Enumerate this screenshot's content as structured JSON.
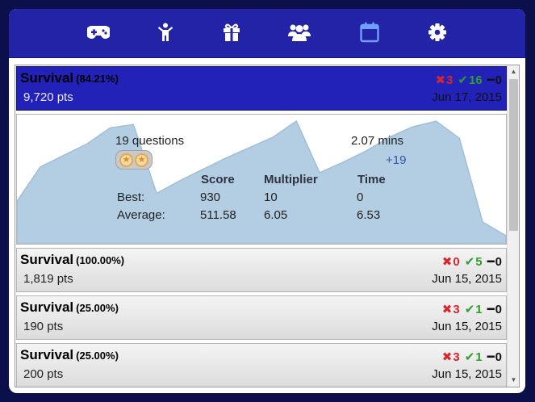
{
  "nav": {
    "icons": [
      "gamepad-icon",
      "person-icon",
      "gift-icon",
      "group-icon",
      "calendar-icon",
      "gear-icon"
    ],
    "active": "calendar-icon",
    "accent_color": "#2323a8",
    "active_color": "#6fa0ff"
  },
  "rows": [
    {
      "title": "Survival",
      "pct": "(84.21%)",
      "pts": "9,720 pts",
      "wrong": "3",
      "right": "16",
      "skip": "0",
      "date": "Jun 17, 2015",
      "selected": true
    },
    {
      "title": "Survival",
      "pct": "(100.00%)",
      "pts": "1,819 pts",
      "wrong": "0",
      "right": "5",
      "skip": "0",
      "date": "Jun 15, 2015"
    },
    {
      "title": "Survival",
      "pct": "(25.00%)",
      "pts": "190 pts",
      "wrong": "3",
      "right": "1",
      "skip": "0",
      "date": "Jun 15, 2015"
    },
    {
      "title": "Survival",
      "pct": "(25.00%)",
      "pts": "200 pts",
      "wrong": "3",
      "right": "1",
      "skip": "0",
      "date": "Jun 15, 2015"
    }
  ],
  "symbols": {
    "wrong": "✖",
    "right": "✔",
    "skip": "━"
  },
  "detail": {
    "questions": "19 questions",
    "time": "2.07 mins",
    "bonus": "+19",
    "medals": 2,
    "table": {
      "headers": [
        "Score",
        "Multiplier",
        "Time"
      ],
      "best_label": "Best:",
      "average_label": "Average:",
      "best": [
        "930",
        "10",
        "0"
      ],
      "average": [
        "511.58",
        "6.05",
        "6.53"
      ]
    }
  },
  "chart_data": {
    "type": "area",
    "values": [
      0.3,
      0.6,
      0.7,
      0.8,
      0.94,
      0.97,
      0.37,
      0.48,
      0.58,
      0.68,
      0.77,
      0.86,
      1.0,
      0.55,
      0.64,
      0.74,
      0.86,
      0.95,
      1.0,
      0.85,
      0.12,
      0.0
    ],
    "color": "#b3cde2",
    "line_color": "#9fbfd9"
  }
}
